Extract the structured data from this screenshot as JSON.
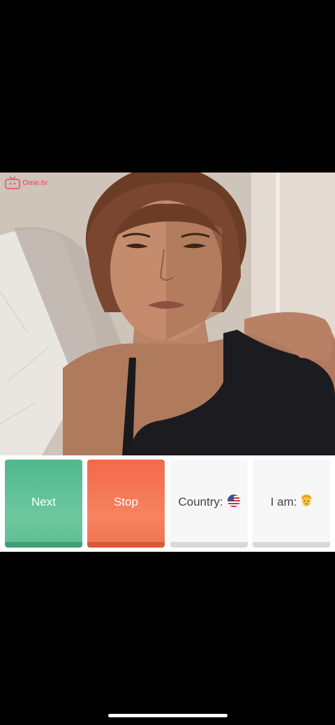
{
  "app": {
    "logo_text": "Ome.tv"
  },
  "controls": {
    "next_label": "Next",
    "stop_label": "Stop",
    "country_label": "Country:",
    "country_flag_icon": "us-flag-icon",
    "iam_label": "I am:",
    "iam_icon": "person-emoji-icon"
  },
  "colors": {
    "next": "#4fb98c",
    "stop": "#f3694a",
    "logo": "#e8657a"
  }
}
